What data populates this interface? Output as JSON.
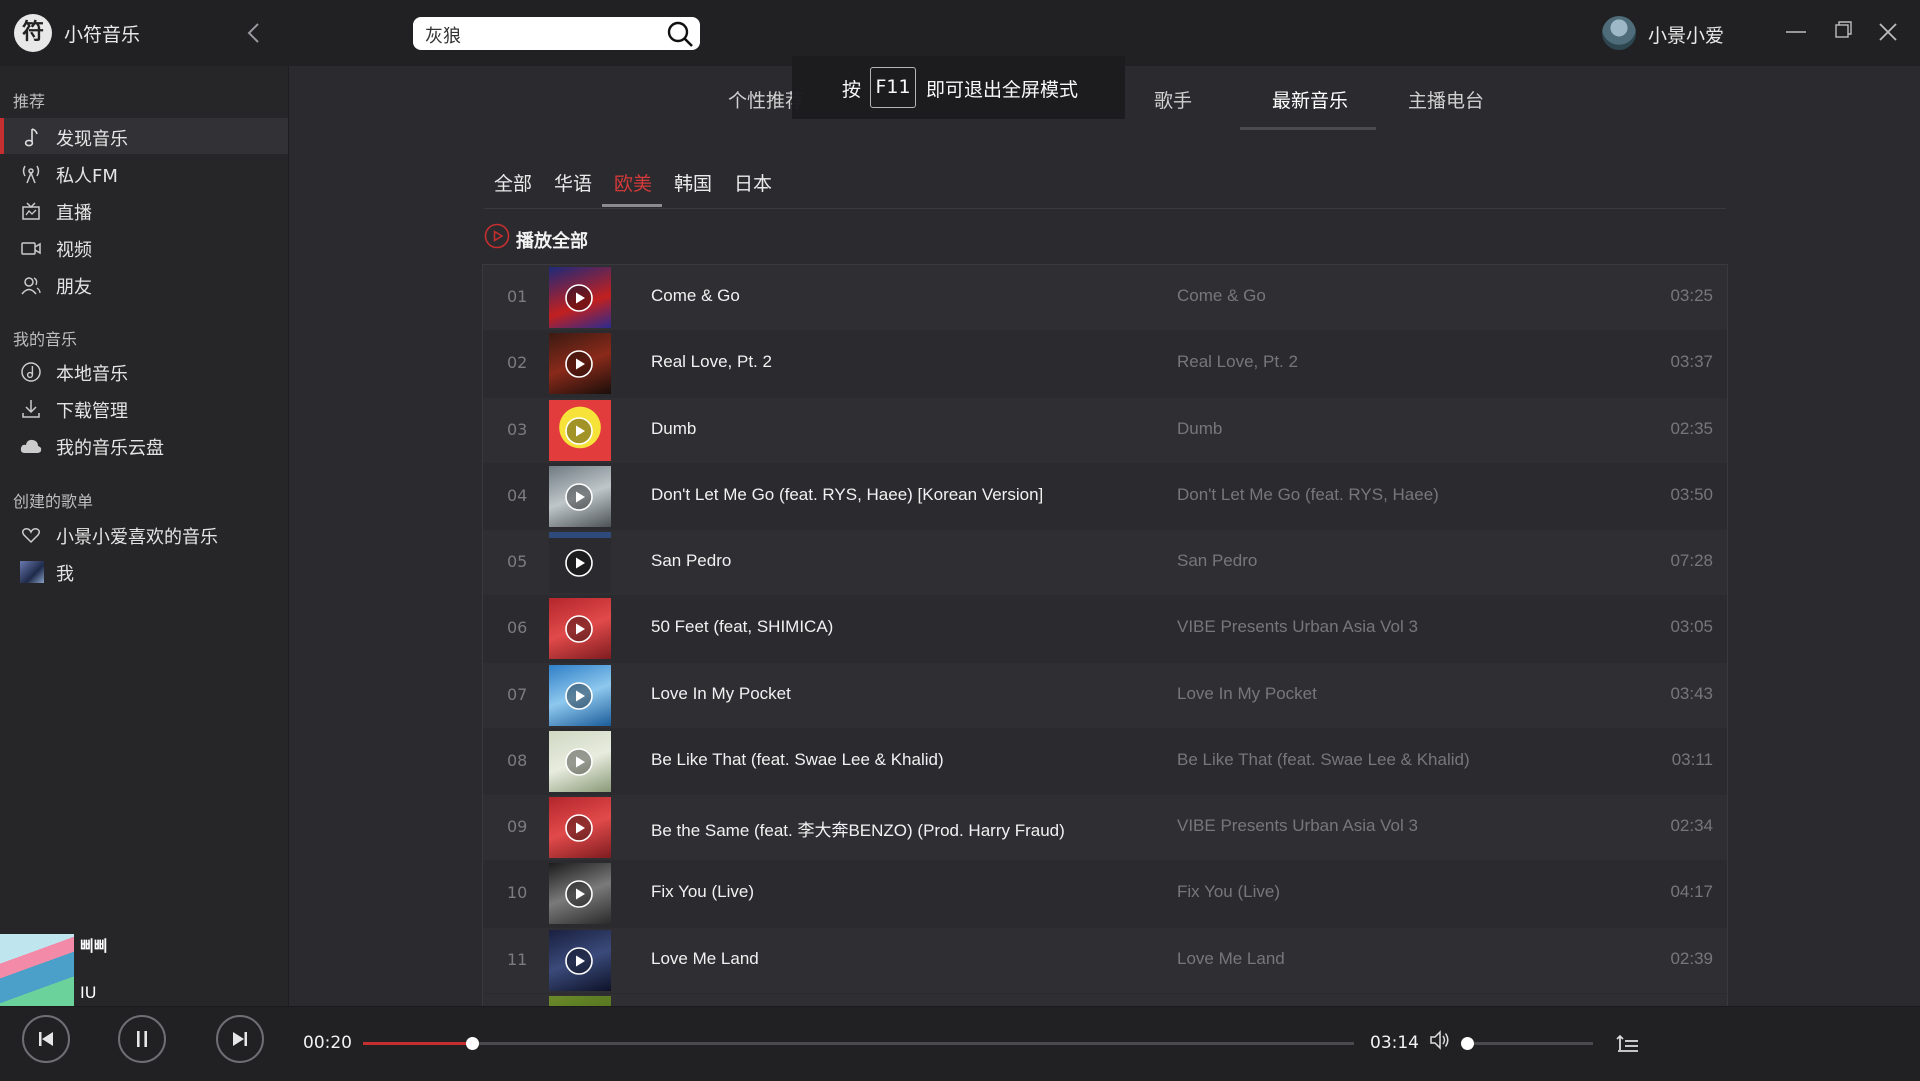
{
  "app": {
    "name": "小符音乐",
    "logo_char": "符",
    "user_name": "小景小爱"
  },
  "search": {
    "value": "灰狼"
  },
  "fullscreen_tip": {
    "prefix": "按",
    "key": "F11",
    "suffix": "即可退出全屏模式"
  },
  "sidebar": {
    "sections": [
      {
        "title": "推荐",
        "items": [
          {
            "label": "发现音乐",
            "icon": "music-note-icon",
            "active": true
          },
          {
            "label": "私人FM",
            "icon": "radio-icon"
          },
          {
            "label": "直播",
            "icon": "live-icon"
          },
          {
            "label": "视频",
            "icon": "video-icon"
          },
          {
            "label": "朋友",
            "icon": "friends-icon"
          }
        ]
      },
      {
        "title": "我的音乐",
        "items": [
          {
            "label": "本地音乐",
            "icon": "local-music-icon"
          },
          {
            "label": "下载管理",
            "icon": "download-icon"
          },
          {
            "label": "我的音乐云盘",
            "icon": "cloud-icon"
          }
        ]
      },
      {
        "title": "创建的歌单",
        "items": [
          {
            "label": "小景小爱喜欢的音乐",
            "icon": "heart-icon"
          },
          {
            "label": "我",
            "icon": "playlist-cover"
          }
        ]
      }
    ]
  },
  "tabs": [
    {
      "label": "个性推荐"
    },
    {
      "label": "歌手"
    },
    {
      "label": "最新音乐",
      "active": true
    },
    {
      "label": "主播电台"
    }
  ],
  "subtabs": [
    {
      "label": "全部"
    },
    {
      "label": "华语"
    },
    {
      "label": "欧美",
      "active": true
    },
    {
      "label": "韩国"
    },
    {
      "label": "日本"
    }
  ],
  "play_all_label": "播放全部",
  "songs": [
    {
      "num": "01",
      "title": "Come & Go",
      "album": "Come & Go",
      "duration": "03:25"
    },
    {
      "num": "02",
      "title": "Real Love, Pt. 2",
      "album": "Real Love, Pt. 2",
      "duration": "03:37"
    },
    {
      "num": "03",
      "title": "Dumb",
      "album": "Dumb",
      "duration": "02:35"
    },
    {
      "num": "04",
      "title": "Don't Let Me Go (feat. RYS, Haee) [Korean Version]",
      "album": "Don't Let Me Go (feat. RYS, Haee)",
      "duration": "03:50"
    },
    {
      "num": "05",
      "title": "San Pedro",
      "album": "San Pedro",
      "duration": "07:28"
    },
    {
      "num": "06",
      "title": "50 Feet (feat, SHIMICA)",
      "album": "VIBE Presents Urban Asia Vol 3",
      "duration": "03:05"
    },
    {
      "num": "07",
      "title": "Love In My Pocket",
      "album": "Love In My Pocket",
      "duration": "03:43"
    },
    {
      "num": "08",
      "title": "Be Like That (feat. Swae Lee & Khalid)",
      "album": "Be Like That (feat. Swae Lee & Khalid)",
      "duration": "03:11"
    },
    {
      "num": "09",
      "title": "Be the Same (feat. 李大奔BENZO) (Prod. Harry Fraud)",
      "album": "VIBE Presents Urban Asia Vol 3",
      "duration": "02:34"
    },
    {
      "num": "10",
      "title": "Fix You (Live)",
      "album": "Fix You (Live)",
      "duration": "04:17"
    },
    {
      "num": "11",
      "title": "Love Me Land",
      "album": "Love Me Land",
      "duration": "02:39"
    }
  ],
  "now_playing": {
    "title": "삐삐",
    "artist": "IU",
    "elapsed": "00:20",
    "total": "03:14",
    "progress": 0.11,
    "volume": 0
  },
  "colors": {
    "accent": "#c62f2f",
    "bg": "#2b2b2f",
    "bar": "#212124"
  }
}
